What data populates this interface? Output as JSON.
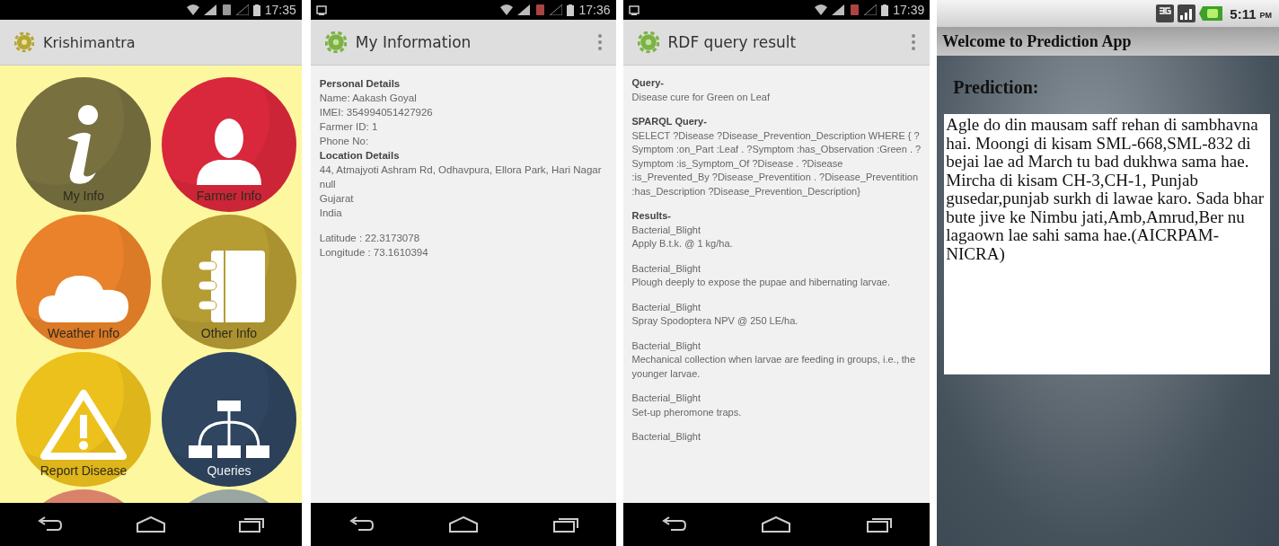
{
  "krishimantra": {
    "status_time": "17:35",
    "title": "Krishimantra",
    "tiles": [
      {
        "label": "My Info",
        "color": "#78703f"
      },
      {
        "label": "Farmer Info",
        "color": "#d9283c"
      },
      {
        "label": "Weather Info",
        "color": "#e9822a"
      },
      {
        "label": "Other Info",
        "color": "#b59c33"
      },
      {
        "label": "Report Disease",
        "color": "#ecc11c"
      },
      {
        "label": "Queries",
        "color": "#2f4560"
      },
      {
        "color": "#d9826a"
      },
      {
        "color": "#9aa6a2"
      }
    ]
  },
  "my_information": {
    "status_time": "17:36",
    "title": "My Information",
    "sections": [
      {
        "heading": "Personal Details",
        "lines": [
          "Name: Aakash Goyal",
          "IMEI: 354994051427926",
          "Farmer ID: 1",
          "Phone No:"
        ]
      },
      {
        "heading": "Location Details",
        "lines": [
          "44, Atmajyoti Ashram Rd, Odhavpura, Ellora Park, Hari Nagar",
          "null",
          "Gujarat",
          "India"
        ]
      }
    ],
    "coordinates": [
      "Latitude : 22.3173078",
      "Longitude : 73.1610394"
    ]
  },
  "rdf_query_result": {
    "status_time": "17:39",
    "title": "RDF query result",
    "query_heading": "Query-",
    "query": "Disease cure for Green on Leaf",
    "sparql_heading": "SPARQL Query-",
    "sparql": "SELECT ?Disease ?Disease_Prevention_Description WHERE { ?Symptom :on_Part :Leaf . ?Symptom :has_Observation :Green . ?Symptom :is_Symptom_Of ?Disease . ?Disease :is_Prevented_By ?Disease_Preventition . ?Disease_Preventition :has_Description ?Disease_Prevention_Description}",
    "results_heading": "Results-",
    "results": [
      {
        "disease": "Bacterial_Blight",
        "description": "Apply B.t.k. @ 1 kg/ha."
      },
      {
        "disease": "Bacterial_Blight",
        "description": "Plough deeply to expose the pupae and hibernating larvae."
      },
      {
        "disease": "Bacterial_Blight",
        "description": "Spray Spodoptera NPV @ 250 LE/ha."
      },
      {
        "disease": "Bacterial_Blight",
        "description": "Mechanical collection when larvae are feeding in groups, i.e., the younger larvae."
      },
      {
        "disease": "Bacterial_Blight",
        "description": "Set-up pheromone traps."
      },
      {
        "disease": "Bacterial_Blight"
      }
    ]
  },
  "prediction_app": {
    "status_time": "5:11",
    "status_period": "PM",
    "title": "Welcome to Prediction App",
    "label": "Prediction:",
    "text": "Agle do din mausam saff rehan di sambhavna hai. Moongi di kisam SML-668,SML-832 di bejai lae ad March tu bad dukhwa sama hae.\nMircha di kisam CH-3,CH-1, Punjab gusedar,punjab surkh di lawae karo. Sada bhar bute jive ke Nimbu jati,Amb,Amrud,Ber nu lagaown lae sahi sama hae.(AICRPAM-NICRA)"
  }
}
